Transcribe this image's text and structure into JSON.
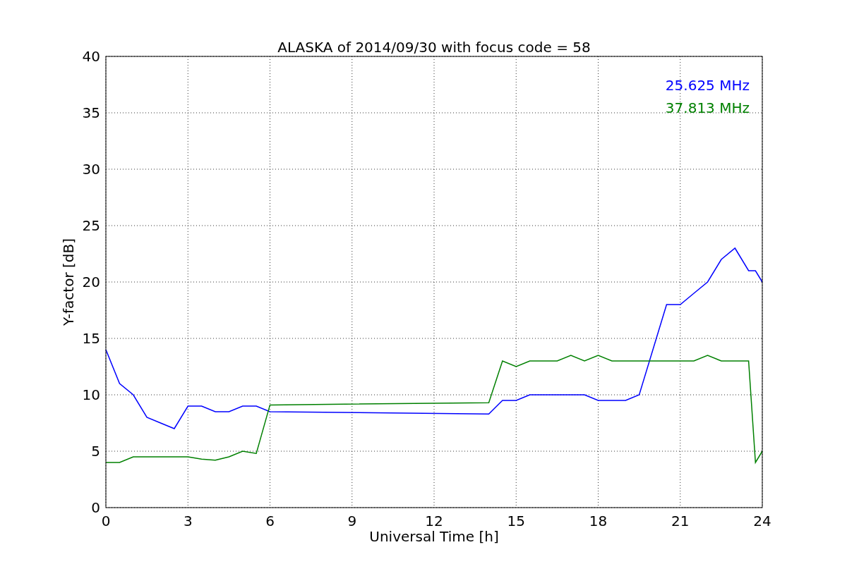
{
  "chart_data": {
    "type": "line",
    "title": "ALASKA of 2014/09/30 with focus code = 58",
    "xlabel": "Universal Time [h]",
    "ylabel": "Y-factor [dB]",
    "x": [
      0,
      0.5,
      1,
      1.5,
      2,
      2.5,
      3,
      3.5,
      4,
      4.5,
      5,
      5.5,
      6,
      14,
      14.5,
      15,
      15.5,
      16,
      16.5,
      17,
      17.5,
      18,
      18.5,
      19,
      19.5,
      20,
      20.5,
      21,
      21.5,
      22,
      22.5,
      23,
      23.5,
      23.75,
      24
    ],
    "series": [
      {
        "name": "25.625 MHz",
        "color": "#0000ff",
        "values": [
          14,
          11,
          10,
          8,
          7.5,
          7,
          9,
          9,
          8.5,
          8.5,
          9,
          9,
          8.5,
          8.3,
          9.5,
          9.5,
          10,
          10,
          10,
          10,
          10,
          9.5,
          9.5,
          9.5,
          10,
          14,
          18,
          18,
          19,
          20,
          22,
          23,
          21,
          21,
          20
        ]
      },
      {
        "name": "37.813 MHz",
        "color": "#008000",
        "values": [
          4,
          4,
          4.5,
          4.5,
          4.5,
          4.5,
          4.5,
          4.3,
          4.2,
          4.5,
          5,
          4.8,
          9.1,
          9.3,
          13,
          12.5,
          13,
          13,
          13,
          13.5,
          13,
          13.5,
          13,
          13,
          13,
          13,
          13,
          13,
          13,
          13.5,
          13,
          13,
          13,
          4,
          5
        ]
      }
    ],
    "xlim": [
      0,
      24
    ],
    "ylim": [
      0,
      40
    ],
    "xticks": [
      0,
      3,
      6,
      9,
      12,
      15,
      18,
      21,
      24
    ],
    "yticks": [
      0,
      5,
      10,
      15,
      20,
      25,
      30,
      35,
      40
    ],
    "grid": true
  }
}
